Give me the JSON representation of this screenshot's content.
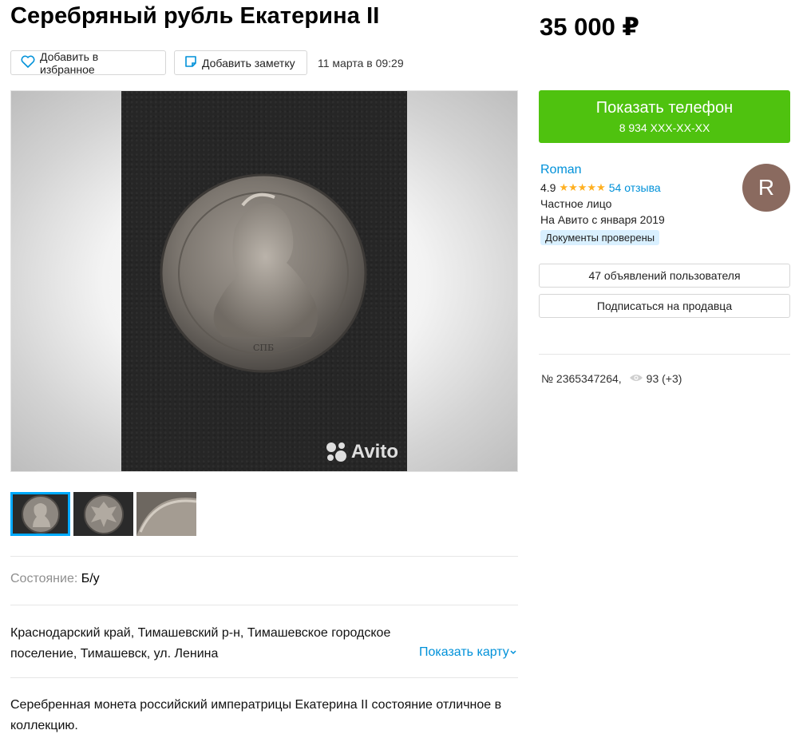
{
  "listing": {
    "title": "Серебряный рубль Екатерина II",
    "favorite_label": "Добавить в избранное",
    "note_label": "Добавить заметку",
    "date": "11 марта в 09:29"
  },
  "gallery": {
    "watermark": "Avito",
    "thumbnails": [
      {
        "name": "coin-obverse"
      },
      {
        "name": "coin-reverse"
      },
      {
        "name": "coin-edge"
      }
    ],
    "active_index": 0
  },
  "params": {
    "condition_label": "Состояние:",
    "condition_value": "Б/у"
  },
  "address": {
    "text": "Краснодарский край, Тимашевский р-н, Тимашевское городское поселение, Тимашевск, ул. Ленина",
    "map_link": "Показать карту"
  },
  "description": "Серебренная монета российский императрицы Екатерина II состояние отличное в коллекцию.",
  "sidebar": {
    "price": "35 000 ₽",
    "phone_button": {
      "label": "Показать телефон",
      "number": "8 934 XXX-XX-XX"
    },
    "seller": {
      "name": "Roman",
      "rating": "4.9",
      "stars": "★★★★★",
      "reviews": "54 отзыва",
      "type": "Частное лицо",
      "since": "На Авито с января 2019",
      "verified": "Документы проверены",
      "avatar_letter": "R",
      "avatar_color": "#8a6a5f"
    },
    "listings_button": "47 объявлений пользователя",
    "subscribe_button": "Подписаться на продавца",
    "ad_number": "№ 2365347264,",
    "views": "93 (+3)"
  },
  "colors": {
    "accent_green": "#4fc20f",
    "link_blue": "#0091d9",
    "thumb_active": "#00aaff",
    "star": "#ffb021"
  },
  "icons": [
    "heart-icon",
    "note-icon",
    "chevron-down-icon",
    "eye-icon",
    "avito-logo-icon",
    "star-icon"
  ]
}
